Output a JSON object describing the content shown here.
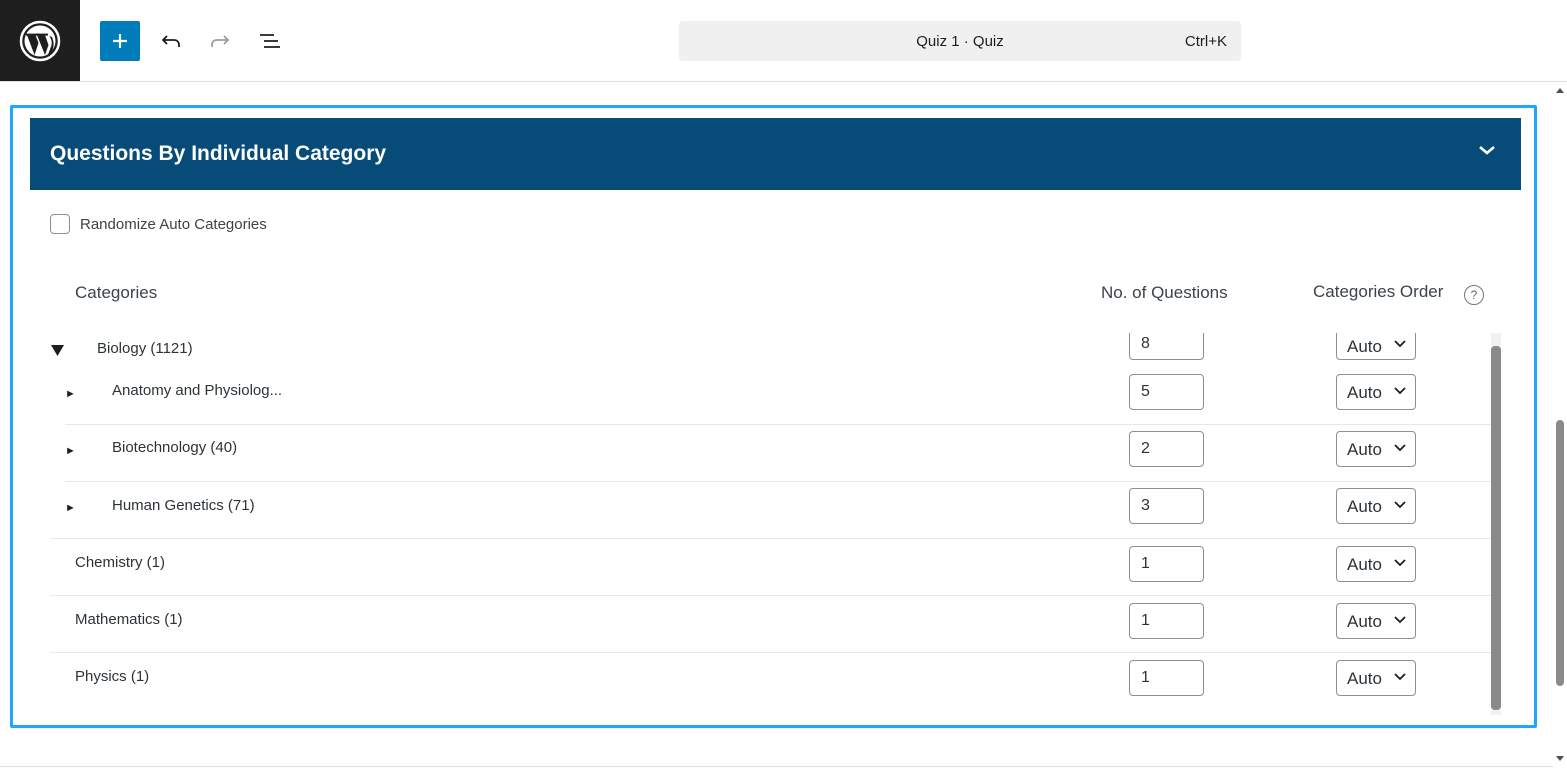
{
  "toolbar": {
    "logo": "wordpress-logo",
    "add_icon": "plus-icon",
    "undo_icon": "undo-icon",
    "redo_icon": "redo-icon",
    "outline_icon": "list-view-icon",
    "document_title": "Quiz 1 · Quiz",
    "shortcut": "Ctrl+K"
  },
  "block": {
    "title": "Questions By Individual Category",
    "randomize_label": "Randomize Auto Categories",
    "randomize_checked": false,
    "columns": {
      "categories": "Categories",
      "questions": "No. of Questions",
      "order": "Categories Order",
      "order_help": "?"
    },
    "rows": [
      {
        "label": "Biology (1121)",
        "level": 0,
        "toggle": "▼",
        "questions": "8",
        "order": "Auto"
      },
      {
        "label": "Anatomy and Physiolog...",
        "level": 1,
        "toggle": "►",
        "questions": "5",
        "order": "Auto"
      },
      {
        "label": "Biotechnology (40)",
        "level": 1,
        "toggle": "►",
        "questions": "2",
        "order": "Auto"
      },
      {
        "label": "Human Genetics (71)",
        "level": 1,
        "toggle": "►",
        "questions": "3",
        "order": "Auto"
      },
      {
        "label": "Chemistry (1)",
        "level": 0,
        "toggle": "",
        "questions": "1",
        "order": "Auto"
      },
      {
        "label": "Mathematics (1)",
        "level": 0,
        "toggle": "",
        "questions": "1",
        "order": "Auto"
      },
      {
        "label": "Physics (1)",
        "level": 0,
        "toggle": "",
        "questions": "1",
        "order": "Auto"
      }
    ]
  },
  "colors": {
    "header_bg": "#074c78",
    "accent": "#007cba",
    "selection_border": "#1ea7fd"
  }
}
